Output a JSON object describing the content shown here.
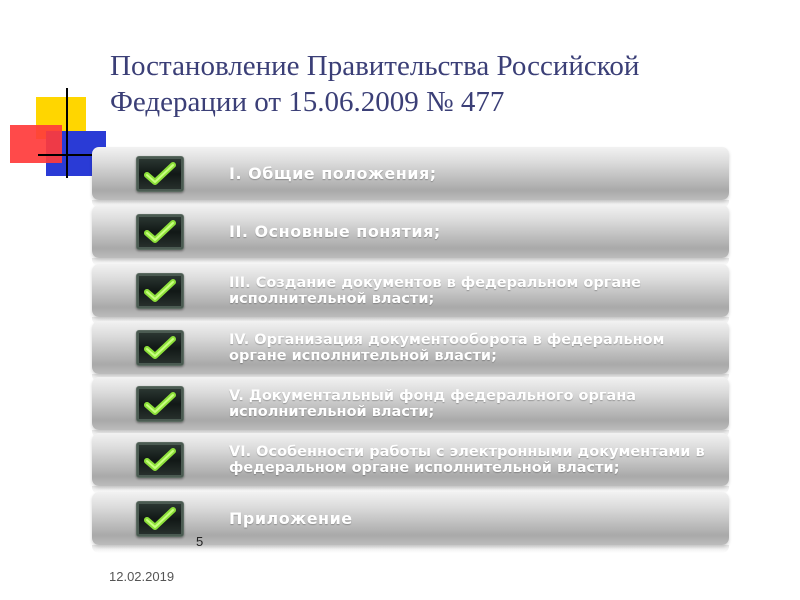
{
  "title": {
    "line1": "Постановление Правительства Российской",
    "line2": "Федерации от 15.06.2009 № 477"
  },
  "items": [
    {
      "label": "I. Общие положения;",
      "icon": "checkmark-icon"
    },
    {
      "label": "II. Основные понятия;",
      "icon": "checkmark-icon"
    },
    {
      "label": "III. Создание документов в федеральном органе исполнительной власти;",
      "icon": "checkmark-icon"
    },
    {
      "label": "IV. Организация документооборота в федеральном органе исполнительной власти;",
      "icon": "checkmark-icon"
    },
    {
      "label": "V. Документальный фонд федерального органа исполнительной власти;",
      "icon": "checkmark-icon"
    },
    {
      "label": "VI. Особенности работы с электронными документами в федеральном органе исполнительной власти;",
      "icon": "checkmark-icon"
    },
    {
      "label": "Приложение",
      "icon": "checkmark-icon"
    }
  ],
  "footer": {
    "page_number": "5",
    "date": "12.02.2019"
  },
  "colors": {
    "title": "#3b3f77",
    "check_green": "#7ed321",
    "deco_yellow": "#ffd600",
    "deco_red": "#ff2a2a",
    "deco_blue": "#2a3bd6"
  }
}
